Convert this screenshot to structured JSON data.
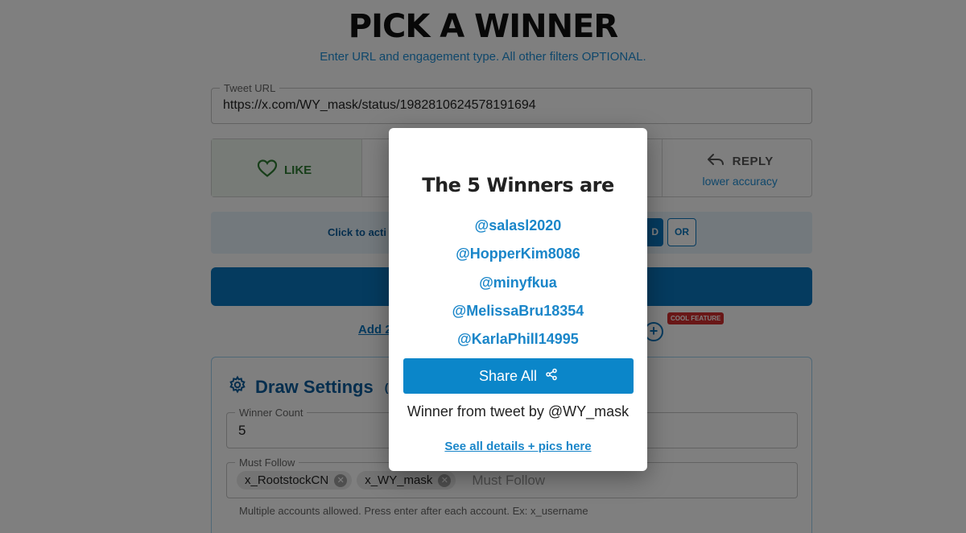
{
  "page": {
    "title": "PICK A WINNER",
    "subtitle": "Enter URL and engagement type. All other filters OPTIONAL."
  },
  "tweet_url": {
    "label": "Tweet URL",
    "value": "https://x.com/WY_mask/status/1982810624578191694"
  },
  "engagement": {
    "like_label": "LIKE",
    "reply_label": "REPLY",
    "reply_note": "lower accuracy"
  },
  "logic": {
    "prompt_partial": "Click to acti",
    "and_partial": "D",
    "or_label": "OR"
  },
  "add_link_partial": "Add 2",
  "cool_badge": "COOL FEATURE",
  "draw_settings": {
    "title": "Draw Settings",
    "optional_partial": "(O",
    "winner_count_label": "Winner Count",
    "winner_count_value": "5",
    "must_follow_label": "Must Follow",
    "must_follow_accounts": [
      "x_RootstockCN",
      "x_WY_mask"
    ],
    "must_follow_placeholder": "Must Follow",
    "help_text": "Multiple accounts allowed. Press enter after each account. Ex: x_username"
  },
  "modal": {
    "title": "The 5 Winners are",
    "winners": [
      "@salasl2020",
      "@HopperKim8086",
      "@minyfkua",
      "@MelissaBru18354",
      "@KarlaPhill14995"
    ],
    "share_label": "Share All",
    "from_text": "Winner from tweet by @WY_mask",
    "details_link": "See all details + pics here"
  },
  "colors": {
    "accent": "#0b76bf",
    "link": "#1a86c9",
    "like_green": "#2e7d32",
    "badge_red": "#d32f2f",
    "overlay": "rgba(0,0,0,0.5)"
  },
  "icons": {
    "like": "heart-icon",
    "reply": "reply-arrow-icon",
    "settings": "gear-icon",
    "share": "share-icon",
    "chip_remove": "close-circle-icon",
    "add": "plus-circle-icon"
  }
}
